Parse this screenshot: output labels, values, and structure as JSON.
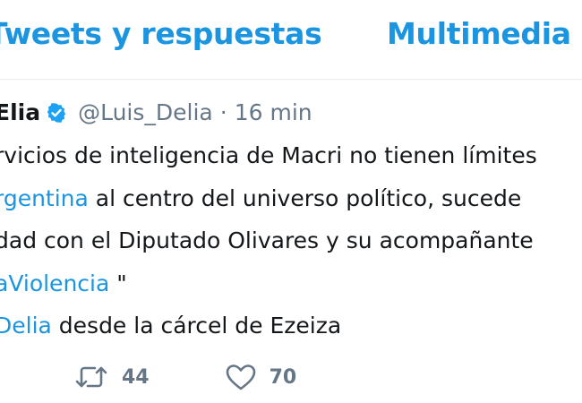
{
  "tabs": [
    {
      "label": "Tweets y respuestas"
    },
    {
      "label": "Multimedia"
    }
  ],
  "tweet": {
    "display_name": "Elia",
    "handle": "@Luis_Delia",
    "separator": "·",
    "time": "16 min",
    "verified_icon": "verified-badge-icon",
    "lines": {
      "l1": "rvicios de inteligencia de Macri no tienen límites",
      "l2_link": "rgentina",
      "l2_text": " al centro del universo político, sucede",
      "l3": "dad con el Diputado  Olivares y su acompañante",
      "l4_link": "aViolencia",
      "l4_text": " \"",
      "l5_link": "Delia",
      "l5_text": " desde la cárcel de Ezeiza"
    },
    "actions": {
      "retweet_icon": "retweet-icon",
      "retweet_count": "44",
      "like_icon": "heart-icon",
      "like_count": "70"
    }
  },
  "colors": {
    "accent": "#1b95e0",
    "text": "#14171a",
    "muted": "#657786",
    "divider": "#e6ecf0"
  }
}
